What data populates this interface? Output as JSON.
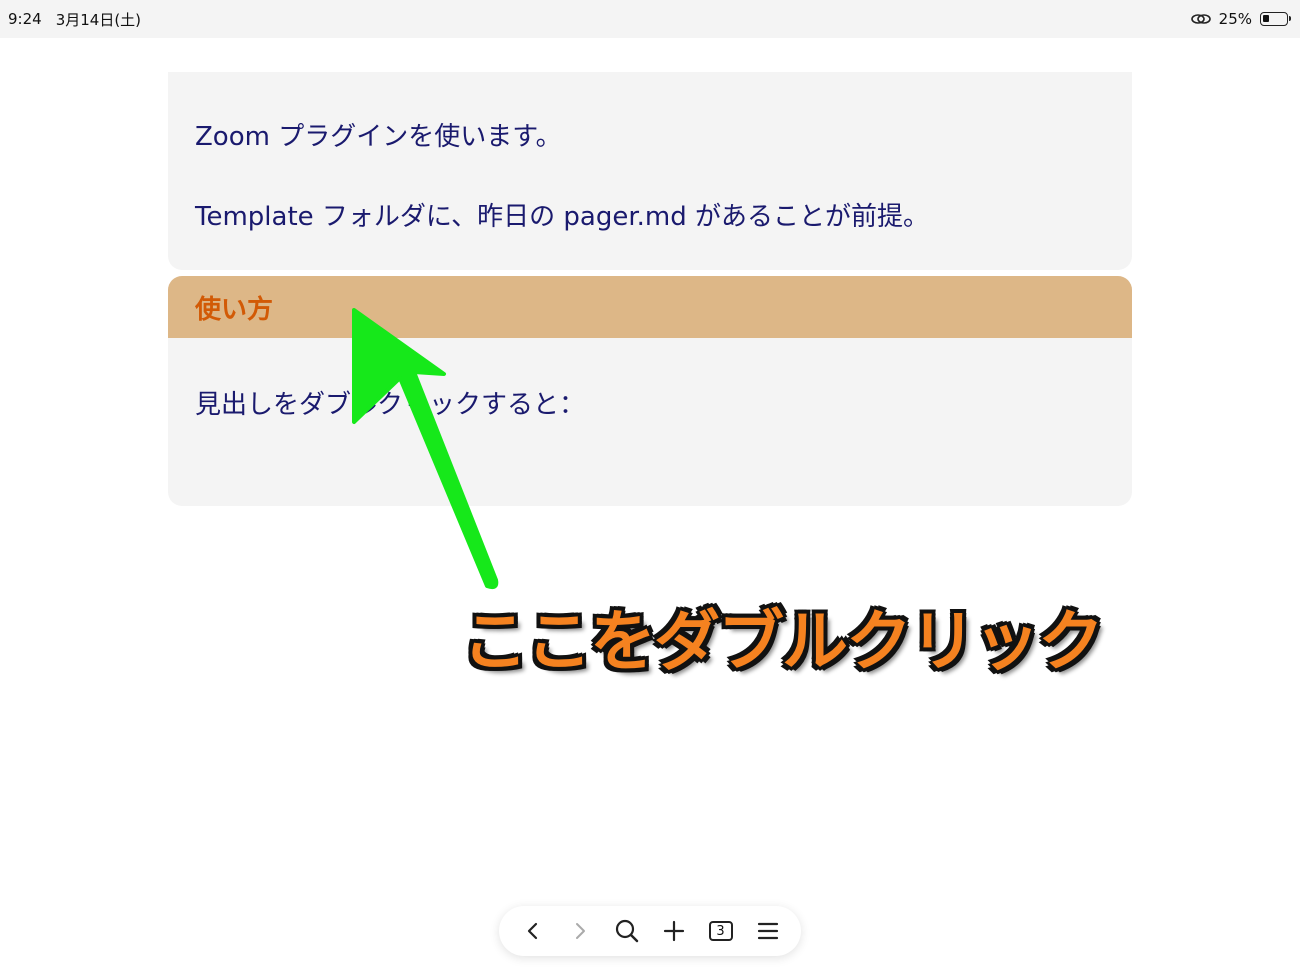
{
  "status": {
    "time": "9:24",
    "date": "3月14日(土)",
    "battery_percent": "25%",
    "battery_level": 0.25
  },
  "content": {
    "para1": "Zoom プラグインを使います。",
    "para2": "Template フォルダに、昨日の pager.md があることが前提。",
    "section_heading": "使い方",
    "section_text": "見出しをダブルクリックすると："
  },
  "annotation": {
    "callout": "ここをダブルクリック",
    "arrow_color": "#16e81a",
    "callout_color": "#f58220"
  },
  "toolbar": {
    "icons": [
      "chevron-left-icon",
      "chevron-right-icon",
      "search-icon",
      "plus-icon",
      "tab-count-icon",
      "menu-icon"
    ],
    "tab_count": "3"
  }
}
